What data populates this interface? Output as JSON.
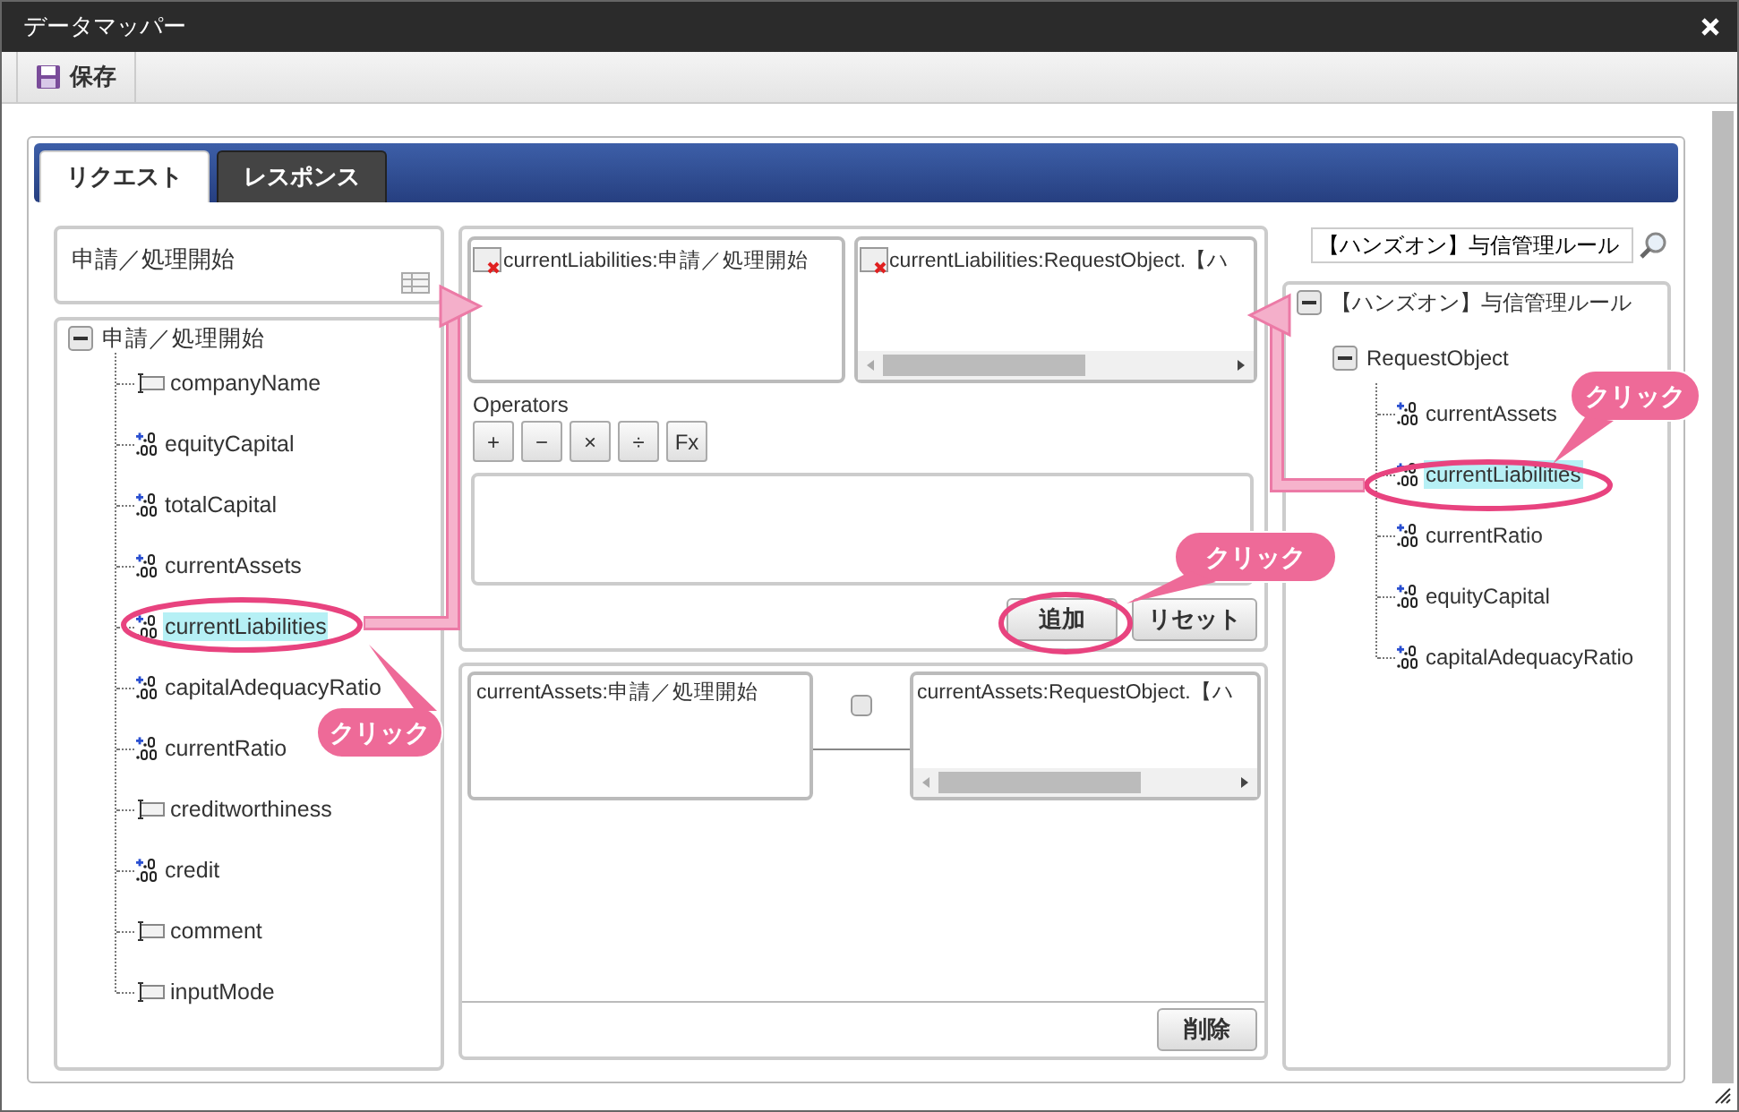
{
  "window": {
    "title": "データマッパー"
  },
  "toolbar": {
    "save_button": "保存"
  },
  "tabs": [
    {
      "label": "リクエスト",
      "selected": true
    },
    {
      "label": "レスポンス",
      "selected": false
    }
  ],
  "source": {
    "name": "申請／処理開始",
    "tree": {
      "label": "申請／処理開始",
      "expanded": true,
      "children": [
        {
          "label": "companyName",
          "kind": "text",
          "selected": false
        },
        {
          "label": "equityCapital",
          "kind": "number",
          "selected": false
        },
        {
          "label": "totalCapital",
          "kind": "number",
          "selected": false
        },
        {
          "label": "currentAssets",
          "kind": "number",
          "selected": false
        },
        {
          "label": "currentLiabilities",
          "kind": "number",
          "selected": true
        },
        {
          "label": "capitalAdequacyRatio",
          "kind": "number",
          "selected": false
        },
        {
          "label": "currentRatio",
          "kind": "number",
          "selected": false
        },
        {
          "label": "creditworthiness",
          "kind": "text",
          "selected": false
        },
        {
          "label": "credit",
          "kind": "number",
          "selected": false
        },
        {
          "label": "comment",
          "kind": "text",
          "selected": false
        },
        {
          "label": "inputMode",
          "kind": "text",
          "selected": false
        }
      ]
    }
  },
  "editor": {
    "source_item": "currentLiabilities:申請／処理開始",
    "target_item": "currentLiabilities:RequestObject.【ハ",
    "operators_label": "Operators",
    "operators": [
      "+",
      "−",
      "×",
      "÷",
      "Fx"
    ],
    "add_button": "追加",
    "reset_button": "リセット"
  },
  "mappings": [
    {
      "source": "currentAssets:申請／処理開始",
      "target": "currentAssets:RequestObject.【ハ",
      "checked": false
    }
  ],
  "delete_button": "削除",
  "target": {
    "search_value": "【ハンズオン】与信管理ルール",
    "tree": {
      "label": "【ハンズオン】与信管理ルール",
      "expanded": true,
      "children": [
        {
          "label": "RequestObject",
          "expanded": true,
          "children": [
            {
              "label": "currentAssets",
              "kind": "number",
              "selected": false
            },
            {
              "label": "currentLiabilities",
              "kind": "number",
              "selected": true
            },
            {
              "label": "currentRatio",
              "kind": "number",
              "selected": false
            },
            {
              "label": "equityCapital",
              "kind": "number",
              "selected": false
            },
            {
              "label": "capitalAdequacyRatio",
              "kind": "number",
              "selected": false
            }
          ]
        }
      ]
    }
  },
  "annotations": [
    {
      "label": "クリック"
    },
    {
      "label": "クリック"
    },
    {
      "label": "クリック"
    }
  ]
}
